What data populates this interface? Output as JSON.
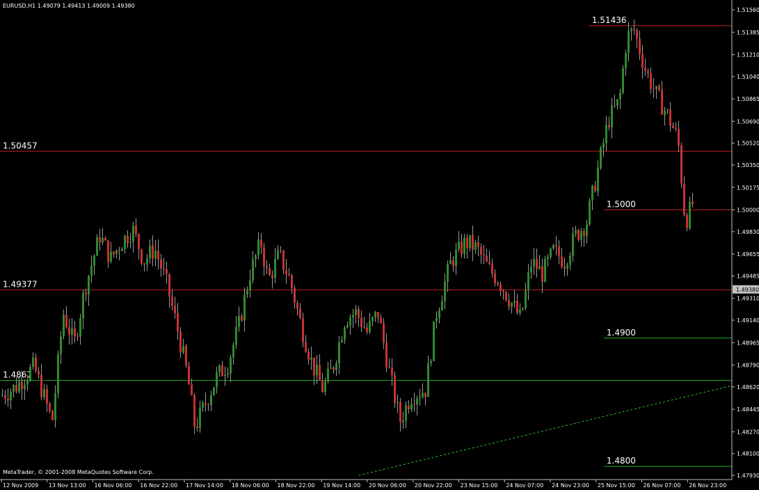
{
  "window": {
    "title": "EURUSD,H1  1.49079 1.49413 1.49009 1.49380",
    "footer": "MetaTrader, © 2001-2008 MetaQuotes Software Corp."
  },
  "colors": {
    "background": "#000000",
    "bull_candle": "#2e8b2e",
    "bear_candle": "#c83232",
    "resistance_line": "#c02020",
    "support_line": "#20b020",
    "trend_line": "#30c030",
    "axis": "#c0c0c0",
    "price_badge": "#c0c0c0"
  },
  "chart_data": {
    "type": "candlestick",
    "symbol": "EURUSD",
    "timeframe": "H1",
    "ylim": [
      1.4793,
      1.5156
    ],
    "y_ticks": [
      "1.51560",
      "1.51385",
      "1.51210",
      "1.51040",
      "1.50865",
      "1.50690",
      "1.50520",
      "1.50350",
      "1.50175",
      "1.50000",
      "1.49830",
      "1.49655",
      "1.49485",
      "1.49310",
      "1.49140",
      "1.48965",
      "1.48790",
      "1.48620",
      "1.48445",
      "1.48270",
      "1.48100",
      "1.47930"
    ],
    "x_ticks": [
      "12 Nov 2009",
      "13 Nov 13:00",
      "16 Nov 06:00",
      "16 Nov 22:00",
      "17 Nov 14:00",
      "18 Nov 06:00",
      "18 Nov 22:00",
      "19 Nov 14:00",
      "20 Nov 06:00",
      "20 Nov 22:00",
      "23 Nov 15:00",
      "24 Nov 07:00",
      "24 Nov 23:00",
      "25 Nov 15:00",
      "26 Nov 07:00",
      "26 Nov 23:00"
    ],
    "current_price": "1.49380",
    "levels": [
      {
        "label": "1.51436",
        "value": 1.51436,
        "kind": "resistance",
        "start": 0.805
      },
      {
        "label": "1.50457",
        "value": 1.50457,
        "kind": "resistance",
        "start": 0.0
      },
      {
        "label": "1.5000",
        "value": 1.5,
        "kind": "resistance",
        "start": 0.825
      },
      {
        "label": "1.49377",
        "value": 1.49377,
        "kind": "resistance",
        "start": 0.0
      },
      {
        "label": "1.4900",
        "value": 1.49,
        "kind": "support",
        "start": 0.825
      },
      {
        "label": "1.4867",
        "value": 1.4867,
        "kind": "support",
        "start": 0.0
      },
      {
        "label": "1.4800",
        "value": 1.48,
        "kind": "support",
        "start": 0.825
      }
    ],
    "trend_line": {
      "from_value": 1.4793,
      "from_pos": 0.49,
      "to_value": 1.4863,
      "to_pos": 1.0
    },
    "close_path": [
      [
        0.0,
        1.4855
      ],
      [
        0.02,
        1.4862
      ],
      [
        0.045,
        1.4878
      ],
      [
        0.07,
        1.4835
      ],
      [
        0.085,
        1.492
      ],
      [
        0.1,
        1.4895
      ],
      [
        0.115,
        1.494
      ],
      [
        0.135,
        1.498
      ],
      [
        0.15,
        1.4962
      ],
      [
        0.165,
        1.4975
      ],
      [
        0.18,
        1.4985
      ],
      [
        0.195,
        1.496
      ],
      [
        0.21,
        1.497
      ],
      [
        0.225,
        1.4945
      ],
      [
        0.24,
        1.491
      ],
      [
        0.255,
        1.487
      ],
      [
        0.265,
        1.483
      ],
      [
        0.28,
        1.485
      ],
      [
        0.295,
        1.487
      ],
      [
        0.31,
        1.488
      ],
      [
        0.325,
        1.491
      ],
      [
        0.34,
        1.495
      ],
      [
        0.355,
        1.4975
      ],
      [
        0.365,
        1.4945
      ],
      [
        0.38,
        1.4965
      ],
      [
        0.395,
        1.4945
      ],
      [
        0.41,
        1.491
      ],
      [
        0.425,
        1.488
      ],
      [
        0.44,
        1.486
      ],
      [
        0.455,
        1.488
      ],
      [
        0.47,
        1.4915
      ],
      [
        0.485,
        1.492
      ],
      [
        0.5,
        1.4905
      ],
      [
        0.515,
        1.492
      ],
      [
        0.53,
        1.4875
      ],
      [
        0.545,
        1.4835
      ],
      [
        0.56,
        1.4855
      ],
      [
        0.58,
        1.486
      ],
      [
        0.595,
        1.492
      ],
      [
        0.615,
        1.496
      ],
      [
        0.635,
        1.4975
      ],
      [
        0.65,
        1.497
      ],
      [
        0.665,
        1.4955
      ],
      [
        0.68,
        1.4945
      ],
      [
        0.695,
        1.493
      ],
      [
        0.71,
        1.4915
      ],
      [
        0.725,
        1.496
      ],
      [
        0.74,
        1.495
      ],
      [
        0.755,
        1.4968
      ],
      [
        0.77,
        1.496
      ],
      [
        0.785,
        1.498
      ],
      [
        0.8,
        1.499
      ],
      [
        0.815,
        1.503
      ],
      [
        0.83,
        1.507
      ],
      [
        0.845,
        1.5085
      ],
      [
        0.855,
        1.5135
      ],
      [
        0.865,
        1.514
      ],
      [
        0.88,
        1.511
      ],
      [
        0.895,
        1.509
      ],
      [
        0.91,
        1.5075
      ],
      [
        0.925,
        1.5055
      ],
      [
        0.935,
        1.499
      ],
      [
        0.945,
        1.5005
      ],
      [
        0.955,
        1.5015
      ],
      [
        0.965,
        1.4995
      ],
      [
        0.975,
        1.4945
      ],
      [
        0.985,
        1.4925
      ],
      [
        0.995,
        1.4938
      ]
    ]
  }
}
